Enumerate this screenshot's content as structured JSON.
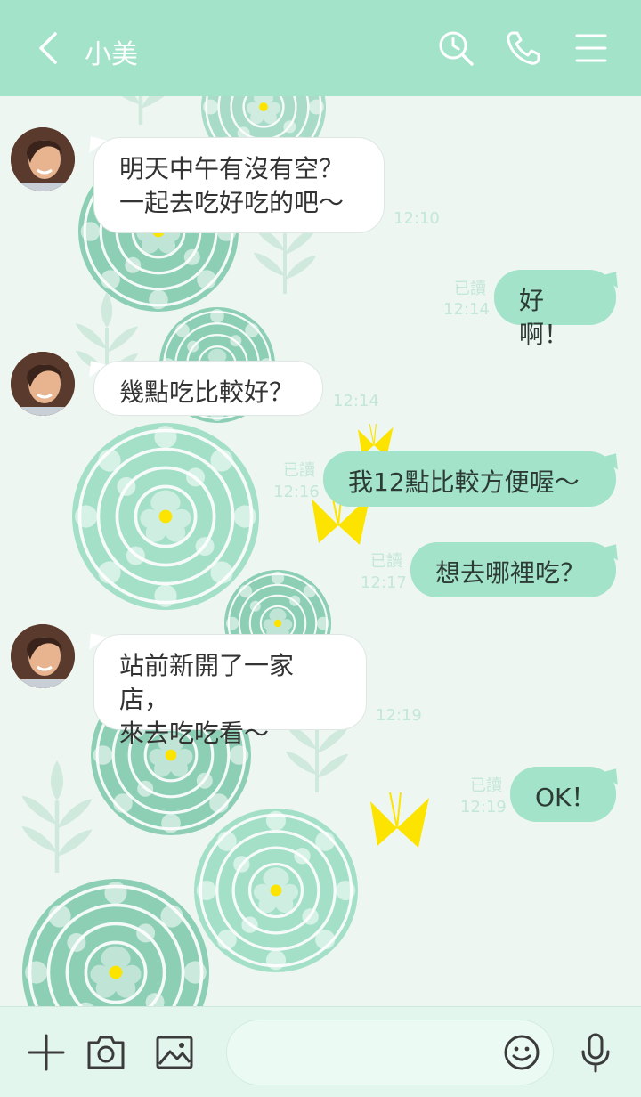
{
  "header": {
    "title": "小美",
    "back_icon": "chevron-left-icon",
    "search_icon": "search-clock-icon",
    "call_icon": "phone-icon",
    "menu_icon": "hamburger-menu-icon"
  },
  "colors": {
    "header_bg": "#a2e3ca",
    "my_bubble": "#a2e3ca",
    "their_bubble": "#ffffff",
    "background": "#eef6f2",
    "meta_text": "#c3e7d8",
    "flower_accent": "#fde400"
  },
  "messages": [
    {
      "side": "left",
      "lines": [
        "明天中午有沒有空？",
        "一起去吃好吃的吧～"
      ],
      "time": "12:10"
    },
    {
      "side": "right",
      "lines": [
        "好啊！"
      ],
      "read": "已讀",
      "time": "12:14"
    },
    {
      "side": "left",
      "lines": [
        "幾點吃比較好？"
      ],
      "time": "12:14"
    },
    {
      "side": "right",
      "lines": [
        "我12點比較方便喔～"
      ],
      "read": "已讀",
      "time": "12:16"
    },
    {
      "side": "right",
      "lines": [
        "想去哪裡吃？"
      ],
      "read": "已讀",
      "time": "12:17"
    },
    {
      "side": "left",
      "lines": [
        "站前新開了一家店，",
        "來去吃吃看～"
      ],
      "time": "12:19"
    },
    {
      "side": "right",
      "lines": [
        "OK！"
      ],
      "read": "已讀",
      "time": "12:19"
    }
  ],
  "input_bar": {
    "add_icon": "plus-icon",
    "camera_icon": "camera-icon",
    "image_icon": "image-icon",
    "emoji_icon": "smiley-icon",
    "mic_icon": "microphone-icon",
    "message_value": ""
  }
}
